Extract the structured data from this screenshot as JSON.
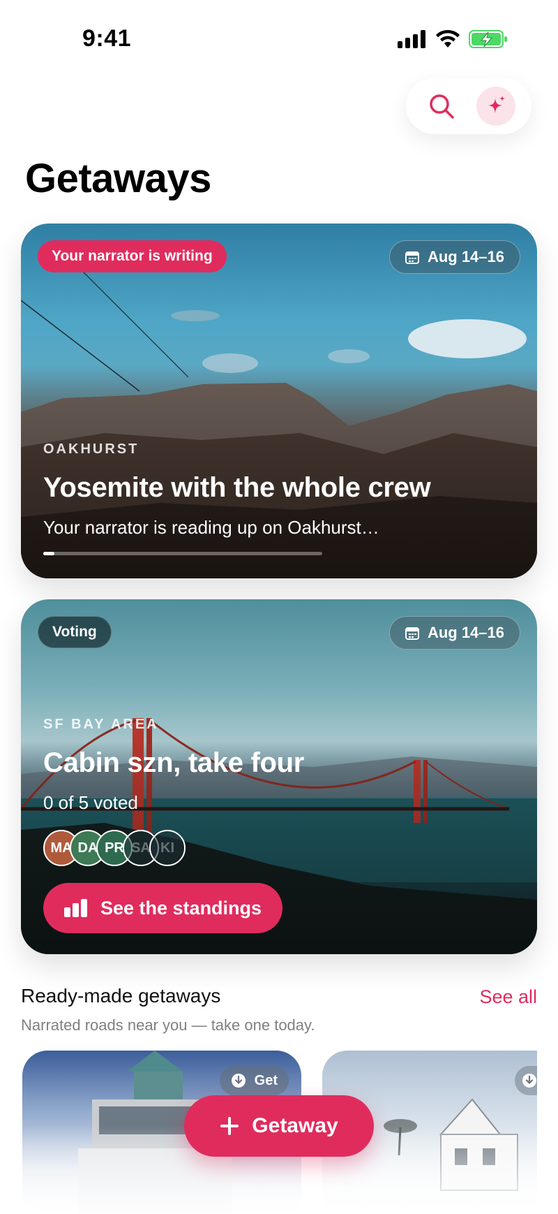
{
  "status_bar": {
    "time": "9:41"
  },
  "page": {
    "title": "Getaways"
  },
  "cards": [
    {
      "status": "Your narrator is writing",
      "date": "Aug 14–16",
      "location": "OAKHURST",
      "title": "Yosemite with the whole crew",
      "subtitle": "Your narrator is reading up on Oakhurst…",
      "progress": 0.04
    },
    {
      "status": "Voting",
      "date": "Aug 14–16",
      "location": "SF BAY AREA",
      "title": "Cabin szn, take four",
      "subtitle": "0 of 5 voted",
      "avatars": [
        "MA",
        "DA",
        "PR",
        "SA",
        "KI"
      ],
      "button": "See the standings"
    }
  ],
  "ready_section": {
    "title": "Ready-made getaways",
    "see_all": "See all",
    "subtitle": "Narrated roads near you — take one today.",
    "get_label": "Get"
  },
  "fab": {
    "label": "Getaway"
  },
  "colors": {
    "accent": "#e02c5d"
  }
}
